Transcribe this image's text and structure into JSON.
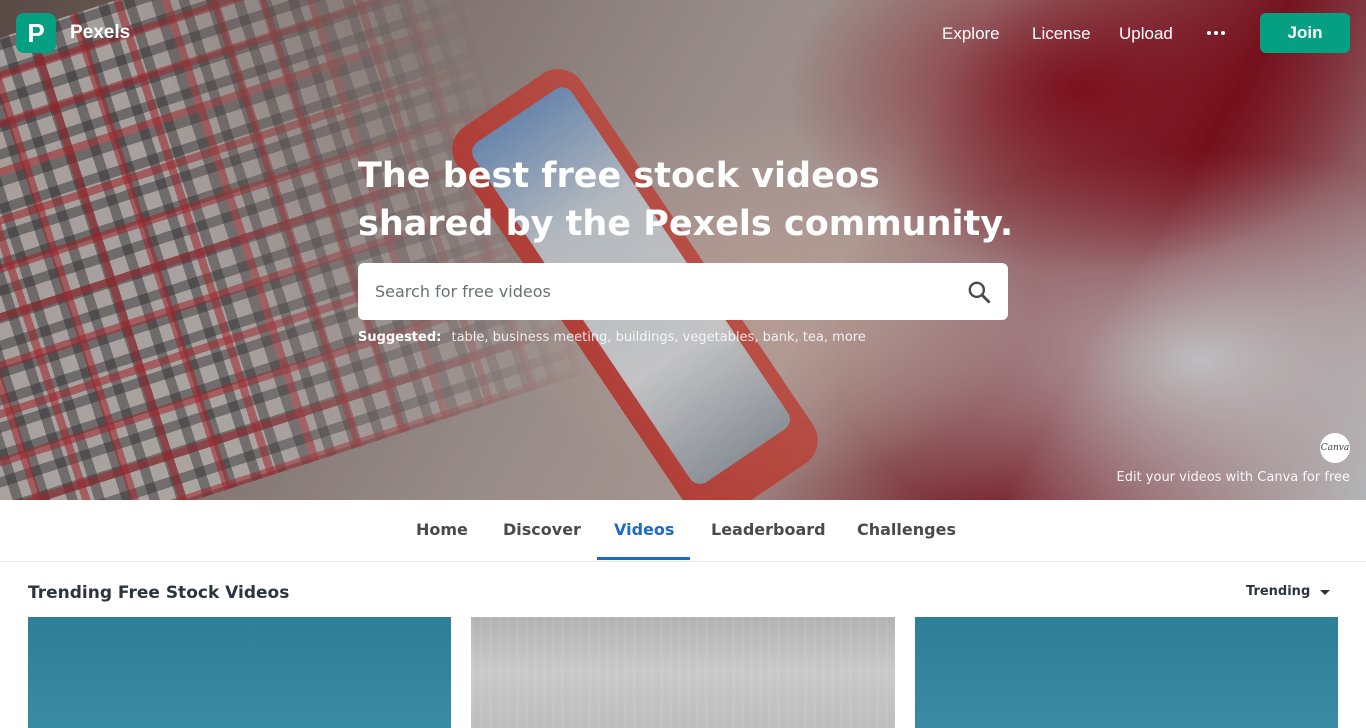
{
  "brand": {
    "logo_letter": "P",
    "name": "Pexels",
    "accent_color": "#05a081"
  },
  "nav": {
    "links": [
      "Explore",
      "License",
      "Upload"
    ],
    "more_icon": "ellipsis-icon",
    "join_label": "Join"
  },
  "hero": {
    "headline": "The best free stock videos shared by the Pexels community.",
    "search": {
      "placeholder": "Search for free videos",
      "icon": "search-icon"
    },
    "suggested": {
      "label": "Suggested:",
      "tags": "table, business meeting, buildings, vegetables, bank, tea, more"
    },
    "canva": {
      "badge_text": "Canva",
      "caption": "Edit your videos with Canva for free"
    }
  },
  "tabs": {
    "items": [
      "Home",
      "Discover",
      "Videos",
      "Leaderboard",
      "Challenges"
    ],
    "active": "Videos",
    "active_color": "#1a6ac8"
  },
  "section": {
    "title": "Trending Free Stock Videos",
    "sort_label": "Trending",
    "sort_icon": "caret-down-icon"
  }
}
